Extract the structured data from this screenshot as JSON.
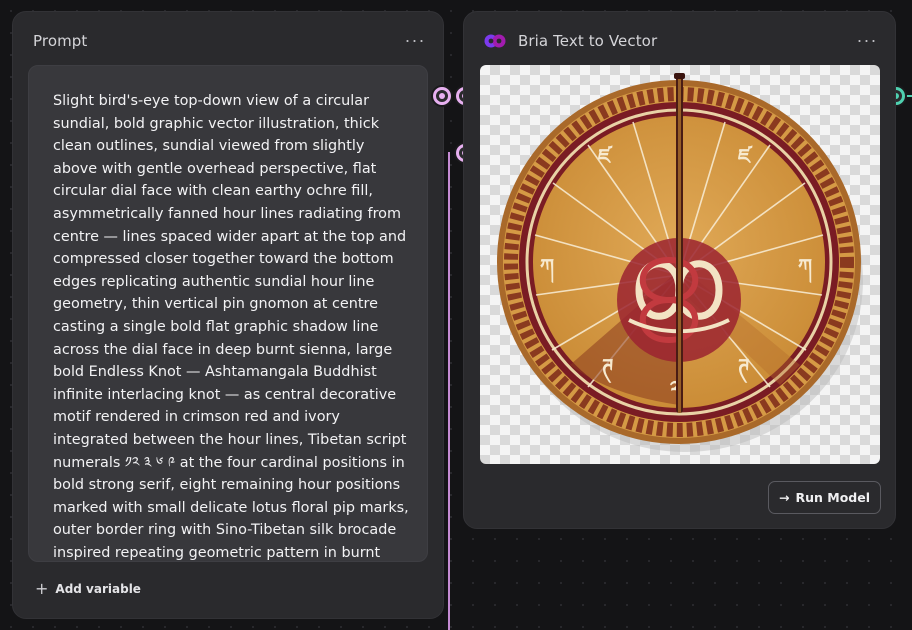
{
  "prompt_node": {
    "title": "Prompt",
    "menu_label": "···",
    "text": "Slight bird's-eye top-down view of a circular sundial, bold graphic vector illustration, thick clean outlines, sundial viewed from slightly above with gentle overhead perspective, flat circular dial face with clean earthy ochre fill, asymmetrically fanned hour lines radiating from centre — lines spaced wider apart at the top and compressed closer together toward the bottom edges replicating authentic sundial hour line geometry, thin vertical pin gnomon at centre casting a single bold flat graphic shadow line across the dial face in deep burnt sienna, large bold Endless Knot — Ashtamangala Buddhist infinite interlacing knot — as central decorative motif rendered in crimson red and ivory integrated between the hour lines, Tibetan script numerals ༡༢ ༣ ༦ ༩ at the four cardinal positions in bold strong serif, eight remaining hour positions marked with small delicate lotus floral pip marks, outer border ring with Sino-Tibetan silk brocade inspired repeating geometric pattern in burnt sienna and ivory, colour",
    "add_variable_label": "Add variable"
  },
  "bria_node": {
    "title": "Bria Text to Vector",
    "menu_label": "···",
    "run_label": "Run Model",
    "brand_color": "#7c3aed"
  },
  "colors": {
    "port": "#e7b0f0",
    "port_output": "#4fd1b0",
    "ochre": "#d39a3f",
    "crimson": "#8e1f2a",
    "gold": "#c98a34"
  }
}
